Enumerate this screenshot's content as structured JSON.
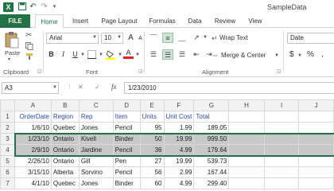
{
  "titlebar": {
    "logo_letter": "X",
    "document_title": "SampleData"
  },
  "tabs": [
    {
      "label": "FILE"
    },
    {
      "label": "Home"
    },
    {
      "label": "Insert"
    },
    {
      "label": "Page Layout"
    },
    {
      "label": "Formulas"
    },
    {
      "label": "Data"
    },
    {
      "label": "Review"
    },
    {
      "label": "View"
    }
  ],
  "ribbon": {
    "clipboard": {
      "paste_label": "Paste",
      "group_label": "Clipboard"
    },
    "font": {
      "font_name": "Arial",
      "font_size": "10",
      "group_label": "Font",
      "bold": "B",
      "italic": "I",
      "underline": "U",
      "grow": "A",
      "shrink": "A",
      "color_letter": "A"
    },
    "alignment": {
      "wrap_text": "Wrap Text",
      "merge_center": "Merge & Center",
      "group_label": "Alignment"
    },
    "number": {
      "format": "Date",
      "currency": "$",
      "percent": "%"
    }
  },
  "formula_bar": {
    "name_box": "A3",
    "fx": "fx",
    "cancel": "✕",
    "enter": "✓",
    "value": "1/23/2010"
  },
  "sheet": {
    "columns": [
      "A",
      "B",
      "C",
      "D",
      "E",
      "F",
      "G",
      "H",
      "I",
      "J"
    ],
    "header_row": [
      "OrderDate",
      "Region",
      "Rep",
      "Item",
      "Units",
      "Unit Cost",
      "Total",
      "",
      "",
      ""
    ],
    "rows": [
      {
        "num": "2",
        "cells": [
          "1/6/10",
          "Quebec",
          "Jones",
          "Pencil",
          "95",
          "1.99",
          "189.05",
          "",
          "",
          ""
        ]
      },
      {
        "num": "3",
        "cells": [
          "1/23/10",
          "Ontario",
          "Kivell",
          "Binder",
          "50",
          "19.99",
          "999.50",
          "",
          "",
          ""
        ]
      },
      {
        "num": "4",
        "cells": [
          "2/9/10",
          "Ontario",
          "Jardine",
          "Pencil",
          "36",
          "4.99",
          "179.64",
          "",
          "",
          ""
        ]
      },
      {
        "num": "5",
        "cells": [
          "2/26/10",
          "Ontario",
          "Gill",
          "Pen",
          "27",
          "19.99",
          "539.73",
          "",
          "",
          ""
        ]
      },
      {
        "num": "6",
        "cells": [
          "3/15/10",
          "Alberta",
          "Sorvino",
          "Pencil",
          "56",
          "2.99",
          "167.44",
          "",
          "",
          ""
        ]
      },
      {
        "num": "7",
        "cells": [
          "4/1/10",
          "Quebec",
          "Jones",
          "Binder",
          "60",
          "4.99",
          "299.40",
          "",
          "",
          ""
        ]
      }
    ],
    "header_row_num": "1"
  }
}
